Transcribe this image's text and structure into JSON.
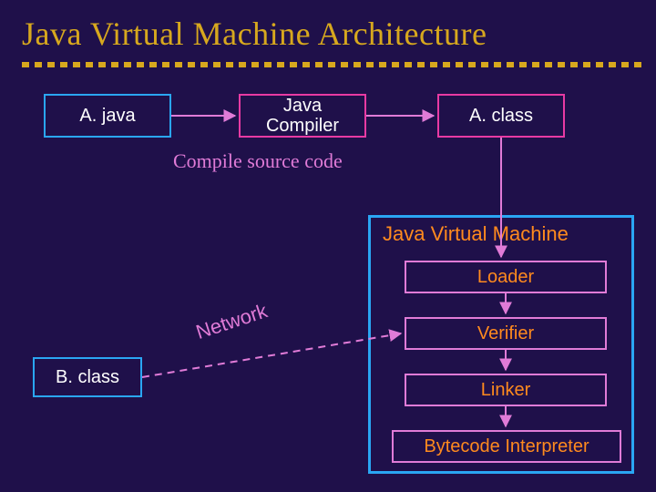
{
  "title": "Java Virtual Machine Architecture",
  "nodes": {
    "a_java": "A. java",
    "compiler": "Java\nCompiler",
    "a_class": "A. class",
    "b_class": "B. class",
    "loader": "Loader",
    "verifier": "Verifier",
    "linker": "Linker",
    "interpreter": "Bytecode Interpreter"
  },
  "jvm_container": "Java Virtual Machine",
  "caption": "Compile source code",
  "edge_label": "Network",
  "colors": {
    "background": "#1f104a",
    "title": "#d7a81e",
    "blue_border": "#2aa6f3",
    "magenta_border": "#e83aa3",
    "pink_border": "#e07bd7",
    "orange_text": "#ff8a1e",
    "white_text": "#ffffff"
  },
  "chart_data": {
    "type": "diagram",
    "title": "Java Virtual Machine Architecture",
    "nodes": [
      {
        "id": "a_java",
        "label": "A. java",
        "group": "source"
      },
      {
        "id": "compiler",
        "label": "Java Compiler",
        "group": "tool"
      },
      {
        "id": "a_class",
        "label": "A. class",
        "group": "bytecode"
      },
      {
        "id": "b_class",
        "label": "B. class",
        "group": "bytecode"
      },
      {
        "id": "jvm",
        "label": "Java Virtual Machine",
        "group": "container"
      },
      {
        "id": "loader",
        "label": "Loader",
        "group": "jvm",
        "parent": "jvm"
      },
      {
        "id": "verifier",
        "label": "Verifier",
        "group": "jvm",
        "parent": "jvm"
      },
      {
        "id": "linker",
        "label": "Linker",
        "group": "jvm",
        "parent": "jvm"
      },
      {
        "id": "interpreter",
        "label": "Bytecode Interpreter",
        "group": "jvm",
        "parent": "jvm"
      }
    ],
    "edges": [
      {
        "from": "a_java",
        "to": "compiler",
        "style": "solid",
        "label": "Compile source code"
      },
      {
        "from": "compiler",
        "to": "a_class",
        "style": "solid"
      },
      {
        "from": "a_class",
        "to": "loader",
        "style": "solid"
      },
      {
        "from": "b_class",
        "to": "linker",
        "style": "dashed",
        "label": "Network"
      },
      {
        "from": "loader",
        "to": "verifier",
        "style": "solid"
      },
      {
        "from": "verifier",
        "to": "linker",
        "style": "solid"
      },
      {
        "from": "linker",
        "to": "interpreter",
        "style": "solid"
      }
    ]
  }
}
